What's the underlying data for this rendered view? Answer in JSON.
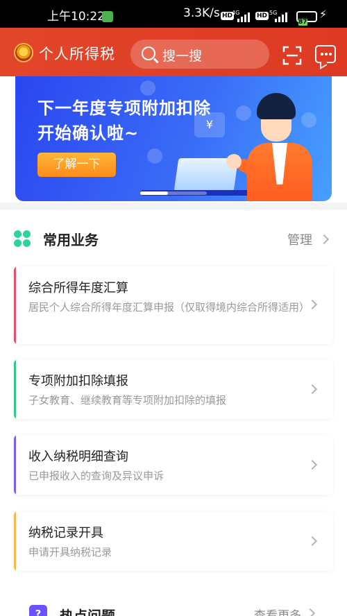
{
  "status_bar": {
    "time": "上午10:22",
    "net_speed": "3.3K/s",
    "hd_label": "HD",
    "net_4g": "4G",
    "net_5g": "5G",
    "battery": "87"
  },
  "header": {
    "title": "个人所得税",
    "search_placeholder": "搜一搜"
  },
  "banner": {
    "line1": "下一年度专项附加扣除",
    "line2": "开始确认啦~",
    "cta": "了解一下",
    "house_symbol": "¥"
  },
  "common": {
    "title": "常用业务",
    "manage": "管理",
    "cards": [
      {
        "title": "综合所得年度汇算",
        "desc": "居民个人综合所得年度汇算申报（仅取得境内综合所得适用）",
        "accent": "#e0506a"
      },
      {
        "title": "专项附加扣除填报",
        "desc": "子女教育、继续教育等专项附加扣除的填报",
        "accent": "#35c889"
      },
      {
        "title": "收入纳税明细查询",
        "desc": "已申报收入的查询及异议申诉",
        "accent": "#7d5cf0"
      },
      {
        "title": "纳税记录开具",
        "desc": "申请开具纳税记录",
        "accent": "#f5b94a"
      }
    ]
  },
  "hot": {
    "badge": "?",
    "title": "热点问题",
    "more": "查看更多"
  }
}
